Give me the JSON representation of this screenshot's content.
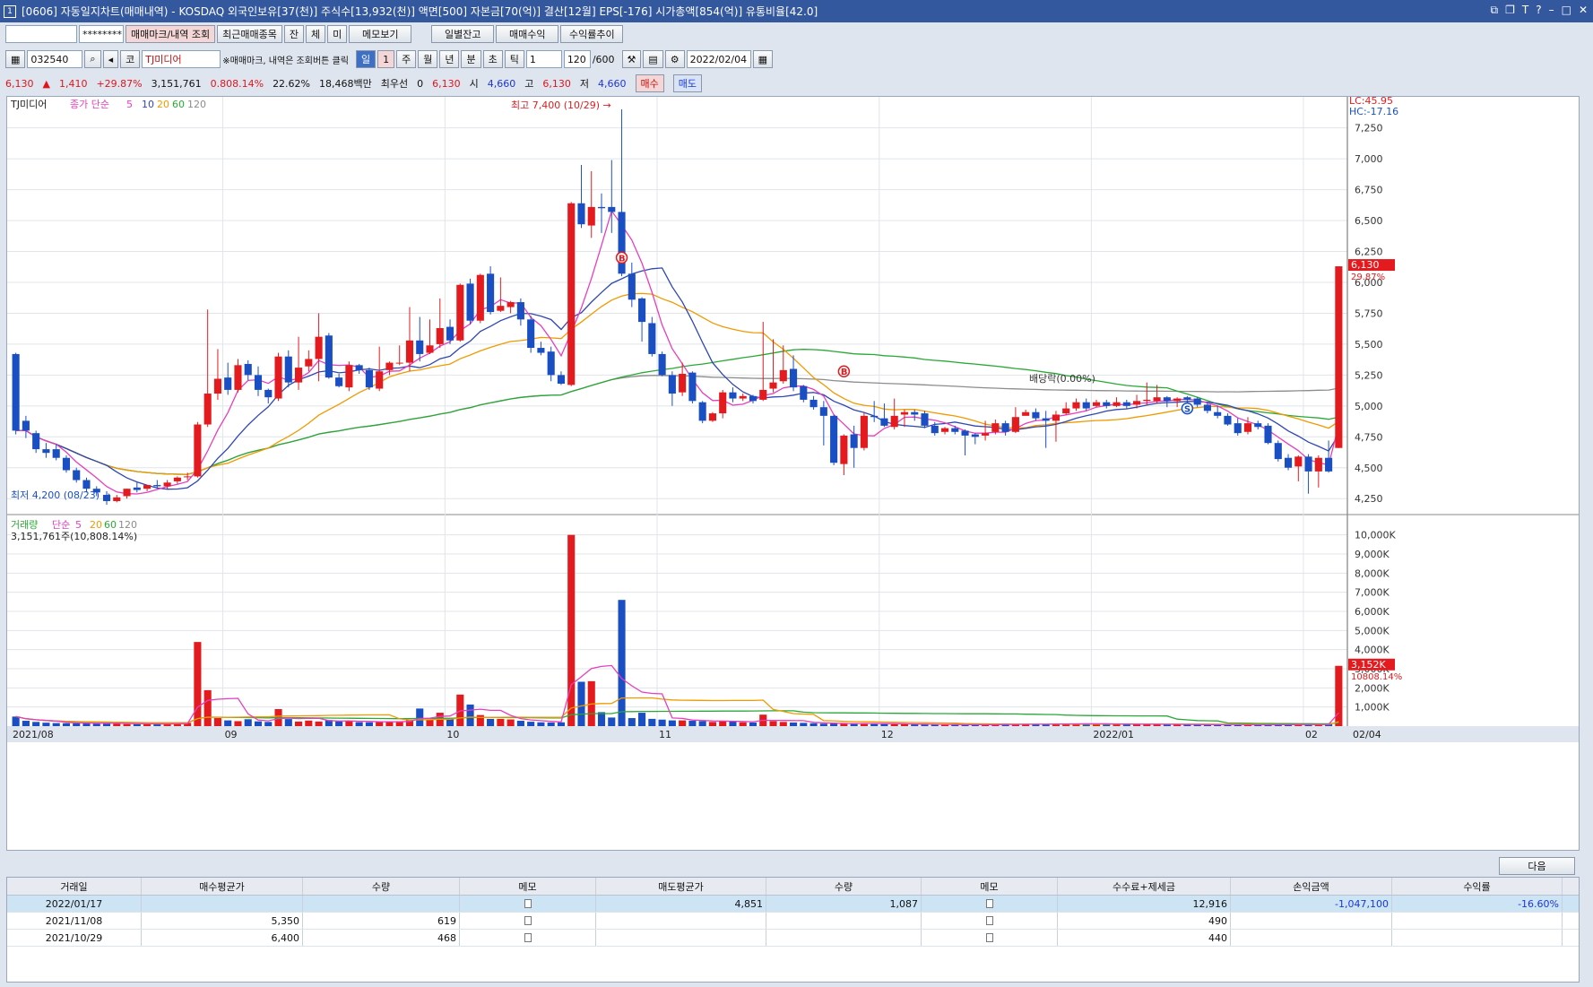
{
  "window": {
    "title": "[0606] 자동일지차트(매매내역) - KOSDAQ 외국인보유[37(천)] 주식수[13,932(천)] 액면[500] 자본금[70(억)] 결산[12월] EPS[-176] 시가총액[854(억)] 유통비율[42.0]",
    "number": "1"
  },
  "toolbar1": {
    "account_value": "",
    "password_value": "********",
    "buttons": [
      "매매마크/내역 조회",
      "최근매매종목",
      "잔",
      "체",
      "미",
      "메모보기",
      "일별잔고",
      "매매수익",
      "수익률추이"
    ]
  },
  "toolbar2": {
    "code": "032540",
    "market": "코",
    "stock_name": "TJ미디어",
    "hint": "※매매마크, 내역은 조회버튼 클릭",
    "periods": [
      "일",
      "1",
      "주",
      "월",
      "년",
      "분",
      "초",
      "틱"
    ],
    "unit": "1",
    "count": "120",
    "max": "/600",
    "date": "2022/02/04"
  },
  "quote": {
    "price": "6,130",
    "change": "1,410",
    "pct": "+29.87%",
    "volume": "3,151,761",
    "vol_ratio": "0.808.14%",
    "turnover": "22.62%",
    "amount": "18,468백만",
    "pref_label": "최우선",
    "pref_val": "0",
    "price2": "6,130",
    "open_label": "시",
    "open": "4,660",
    "high_label": "고",
    "high": "6,130",
    "low_label": "저",
    "low": "4,660",
    "buy": "매수",
    "sell": "매도"
  },
  "legend": {
    "name": "TJ미디어",
    "ma_label": "종가 단순",
    "ma": [
      "5",
      "10",
      "20",
      "60",
      "120"
    ],
    "vol_name": "거래량",
    "vol_ma_label": "단순",
    "vol_ma": [
      "5",
      "20",
      "60",
      "120"
    ],
    "vol_value": "3,151,761주(10,808.14%)"
  },
  "annotations": {
    "high": "최고 7,400 (10/29)",
    "low": "최저 4,200 (08/23)",
    "dividend": "배당락(0.00%)",
    "lc": "LC:45.95",
    "hc": "HC:-17.16",
    "price_tag": "6,130",
    "pct_tag": "29.87%",
    "vol_tag": "3,152K",
    "vol_pct_tag": "10808.14%"
  },
  "chart_data": {
    "type": "candlestick",
    "y_ticks": [
      "7,250",
      "7,000",
      "6,750",
      "6,500",
      "6,250",
      "6,000",
      "5,750",
      "5,500",
      "5,250",
      "5,000",
      "4,750",
      "4,500",
      "4,250"
    ],
    "vol_ticks": [
      "10,000K",
      "9,000K",
      "8,000K",
      "7,000K",
      "6,000K",
      "5,000K",
      "4,000K",
      "3,000K",
      "2,000K",
      "1,000K"
    ],
    "x_labels": [
      "2021/08",
      "09",
      "10",
      "11",
      "12",
      "2022/01",
      "02",
      "02/04"
    ],
    "ylim": [
      4150,
      7400
    ],
    "vol_max": 10500,
    "candles": [
      [
        5420,
        4800,
        5430,
        4770,
        500
      ],
      [
        4880,
        4800,
        4920,
        4740,
        280
      ],
      [
        4780,
        4650,
        4800,
        4620,
        220
      ],
      [
        4650,
        4620,
        4700,
        4580,
        180
      ],
      [
        4650,
        4580,
        4690,
        4560,
        160
      ],
      [
        4580,
        4480,
        4600,
        4460,
        150
      ],
      [
        4480,
        4400,
        4500,
        4380,
        150
      ],
      [
        4400,
        4330,
        4420,
        4300,
        160
      ],
      [
        4330,
        4300,
        4350,
        4270,
        140
      ],
      [
        4280,
        4230,
        4310,
        4200,
        150
      ],
      [
        4230,
        4260,
        4280,
        4220,
        120
      ],
      [
        4270,
        4330,
        4330,
        4250,
        110
      ],
      [
        4340,
        4320,
        4380,
        4300,
        120
      ],
      [
        4330,
        4360,
        4360,
        4310,
        100
      ],
      [
        4360,
        4350,
        4400,
        4330,
        110
      ],
      [
        4350,
        4380,
        4400,
        4330,
        130
      ],
      [
        4390,
        4420,
        4430,
        4370,
        150
      ],
      [
        4430,
        4430,
        4460,
        4400,
        170
      ],
      [
        4430,
        4850,
        4870,
        4420,
        4400
      ],
      [
        4850,
        5100,
        5780,
        4830,
        1880
      ],
      [
        5100,
        5220,
        5460,
        5050,
        420
      ],
      [
        5230,
        5130,
        5350,
        5090,
        300
      ],
      [
        5130,
        5330,
        5380,
        5110,
        260
      ],
      [
        5340,
        5250,
        5370,
        5210,
        360
      ],
      [
        5250,
        5130,
        5320,
        5080,
        250
      ],
      [
        5130,
        5070,
        5140,
        5020,
        220
      ],
      [
        5060,
        5400,
        5430,
        5040,
        890
      ],
      [
        5400,
        5190,
        5450,
        5150,
        370
      ],
      [
        5190,
        5310,
        5560,
        5130,
        240
      ],
      [
        5320,
        5380,
        5450,
        5280,
        290
      ],
      [
        5380,
        5560,
        5750,
        5200,
        240
      ],
      [
        5570,
        5230,
        5590,
        5220,
        320
      ],
      [
        5230,
        5160,
        5260,
        5150,
        250
      ],
      [
        5150,
        5330,
        5360,
        5120,
        270
      ],
      [
        5330,
        5290,
        5340,
        5260,
        210
      ],
      [
        5290,
        5150,
        5310,
        5130,
        200
      ],
      [
        5140,
        5280,
        5480,
        5120,
        210
      ],
      [
        5290,
        5350,
        5360,
        5250,
        250
      ],
      [
        5350,
        5350,
        5490,
        5330,
        260
      ],
      [
        5350,
        5530,
        5800,
        5280,
        330
      ],
      [
        5530,
        5420,
        5720,
        5360,
        920
      ],
      [
        5430,
        5490,
        5700,
        5420,
        330
      ],
      [
        5500,
        5630,
        5870,
        5470,
        700
      ],
      [
        5640,
        5530,
        5700,
        5500,
        380
      ],
      [
        5530,
        5980,
        5990,
        5520,
        1650
      ],
      [
        5990,
        5690,
        6030,
        5660,
        1130
      ],
      [
        5690,
        6060,
        6070,
        5670,
        580
      ],
      [
        6070,
        5760,
        6130,
        5740,
        380
      ],
      [
        5770,
        5810,
        6040,
        5760,
        380
      ],
      [
        5800,
        5840,
        5850,
        5750,
        350
      ],
      [
        5840,
        5700,
        5870,
        5650,
        280
      ],
      [
        5700,
        5470,
        5730,
        5430,
        230
      ],
      [
        5470,
        5430,
        5520,
        5410,
        200
      ],
      [
        5440,
        5250,
        5480,
        5200,
        190
      ],
      [
        5250,
        5180,
        5280,
        5170,
        200
      ],
      [
        5170,
        6640,
        6650,
        5160,
        10000
      ],
      [
        6640,
        6470,
        6950,
        6440,
        2320
      ],
      [
        6460,
        6610,
        6900,
        6360,
        2350
      ],
      [
        6610,
        6600,
        6720,
        6400,
        730
      ],
      [
        6610,
        6570,
        6990,
        6400,
        450
      ],
      [
        6570,
        6070,
        7400,
        6050,
        6600
      ],
      [
        6070,
        5860,
        6160,
        5800,
        420
      ],
      [
        5870,
        5680,
        5880,
        5520,
        700
      ],
      [
        5670,
        5420,
        5720,
        5400,
        380
      ],
      [
        5420,
        5250,
        5440,
        5240,
        340
      ],
      [
        5250,
        5100,
        5280,
        5000,
        300
      ],
      [
        5110,
        5260,
        5350,
        5080,
        300
      ],
      [
        5270,
        5040,
        5280,
        5020,
        280
      ],
      [
        5030,
        4880,
        5040,
        4860,
        260
      ],
      [
        4880,
        4940,
        4950,
        4870,
        220
      ],
      [
        4940,
        5110,
        5130,
        4900,
        280
      ],
      [
        5110,
        5060,
        5150,
        5030,
        250
      ],
      [
        5060,
        5080,
        5100,
        5040,
        200
      ],
      [
        5080,
        5040,
        5090,
        5020,
        190
      ],
      [
        5050,
        5130,
        5680,
        5040,
        600
      ],
      [
        5140,
        5190,
        5540,
        5110,
        260
      ],
      [
        5200,
        5290,
        5490,
        5180,
        220
      ],
      [
        5300,
        5150,
        5410,
        5120,
        190
      ],
      [
        5160,
        5050,
        5170,
        5030,
        170
      ],
      [
        5050,
        4990,
        5080,
        4970,
        150
      ],
      [
        4990,
        4920,
        5040,
        4680,
        130
      ],
      [
        4920,
        4540,
        4930,
        4520,
        140
      ],
      [
        4530,
        4760,
        4770,
        4440,
        120
      ],
      [
        4770,
        4660,
        4840,
        4500,
        130
      ],
      [
        4660,
        4920,
        4950,
        4640,
        150
      ],
      [
        4920,
        4910,
        5040,
        4870,
        130
      ],
      [
        4900,
        4840,
        5020,
        4830,
        120
      ],
      [
        4830,
        4920,
        5060,
        4810,
        110
      ],
      [
        4930,
        4950,
        4970,
        4830,
        100
      ],
      [
        4950,
        4930,
        4970,
        4880,
        90
      ],
      [
        4940,
        4840,
        4960,
        4820,
        90
      ],
      [
        4840,
        4780,
        4870,
        4760,
        80
      ],
      [
        4790,
        4820,
        4830,
        4770,
        80
      ],
      [
        4820,
        4790,
        4840,
        4770,
        80
      ],
      [
        4800,
        4760,
        4810,
        4600,
        80
      ],
      [
        4770,
        4750,
        4780,
        4690,
        80
      ],
      [
        4760,
        4780,
        4880,
        4720,
        80
      ],
      [
        4790,
        4860,
        4890,
        4770,
        90
      ],
      [
        4860,
        4790,
        4880,
        4760,
        90
      ],
      [
        4790,
        4910,
        4990,
        4780,
        100
      ],
      [
        4920,
        4950,
        4970,
        4930,
        110
      ],
      [
        4950,
        4900,
        4980,
        4880,
        100
      ],
      [
        4900,
        4880,
        4960,
        4660,
        100
      ],
      [
        4880,
        4930,
        4960,
        4710,
        120
      ],
      [
        4940,
        4980,
        5030,
        4930,
        130
      ],
      [
        4980,
        5030,
        5060,
        4960,
        140
      ],
      [
        5030,
        4980,
        5060,
        4960,
        120
      ],
      [
        5000,
        5030,
        5050,
        4990,
        110
      ],
      [
        5030,
        5000,
        5050,
        4980,
        100
      ],
      [
        5000,
        5030,
        5070,
        4990,
        100
      ],
      [
        5030,
        5000,
        5050,
        4980,
        100
      ],
      [
        5010,
        5040,
        5090,
        4980,
        100
      ],
      [
        5040,
        5050,
        5190,
        5010,
        100
      ],
      [
        5040,
        5070,
        5170,
        5020,
        90
      ],
      [
        5070,
        5040,
        5080,
        4990,
        90
      ],
      [
        5040,
        5060,
        5070,
        4990,
        80
      ],
      [
        5070,
        5050,
        5080,
        5020,
        80
      ],
      [
        5060,
        5010,
        5070,
        4990,
        80
      ],
      [
        5010,
        4960,
        5030,
        4940,
        80
      ],
      [
        4950,
        4920,
        5000,
        4900,
        70
      ],
      [
        4920,
        4850,
        4940,
        4840,
        70
      ],
      [
        4860,
        4780,
        4900,
        4760,
        70
      ],
      [
        4790,
        4860,
        4910,
        4770,
        70
      ],
      [
        4860,
        4830,
        4880,
        4810,
        70
      ],
      [
        4840,
        4700,
        4860,
        4690,
        80
      ],
      [
        4700,
        4570,
        4720,
        4550,
        100
      ],
      [
        4580,
        4500,
        4610,
        4480,
        90
      ],
      [
        4510,
        4590,
        4600,
        4390,
        90
      ],
      [
        4590,
        4470,
        4610,
        4290,
        80
      ],
      [
        4470,
        4580,
        4600,
        4340,
        80
      ],
      [
        4580,
        4470,
        4720,
        4460,
        110
      ],
      [
        4660,
        6130,
        6130,
        4660,
        3152
      ]
    ]
  },
  "marks": [
    {
      "label": "B"
    },
    {
      "label": "B"
    },
    {
      "label": "S"
    }
  ],
  "table": {
    "headers": [
      "거래일",
      "매수평균가",
      "수량",
      "메모",
      "매도평균가",
      "수량",
      "메모",
      "수수료+제세금",
      "손익금액",
      "수익률"
    ],
    "rows": [
      [
        "2022/01/17",
        "",
        "",
        "",
        "4,851",
        "1,087",
        "",
        "12,916",
        "-1,047,100",
        "-16.60%"
      ],
      [
        "2021/11/08",
        "5,350",
        "619",
        "",
        "",
        "",
        "",
        "490",
        "",
        ""
      ],
      [
        "2021/10/29",
        "6,400",
        "468",
        "",
        "",
        "",
        "",
        "440",
        "",
        ""
      ]
    ],
    "next": "다음"
  },
  "colors": {
    "up": "#e31b1e",
    "down": "#1a4fc4",
    "ma5": "#e53fbd",
    "ma10": "#2f47b0",
    "ma20": "#f09a00",
    "ma60": "#2aa836",
    "ma120": "#8c8c8c",
    "grid": "#e1e5ea"
  }
}
